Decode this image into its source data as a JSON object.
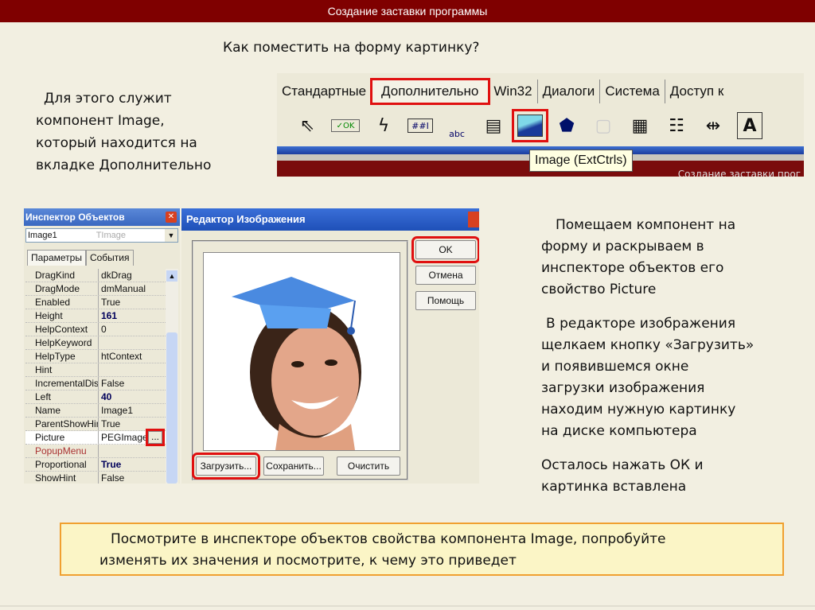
{
  "slide_title": "Создание заставки программы",
  "question": "Как поместить на форму картинку?",
  "left_text": [
    "Для этого служит",
    "компонент Image,",
    "который находится на",
    "вкладке Дополнительно"
  ],
  "palette": {
    "tabs": [
      "Стандартные",
      "Дополнительно",
      "Win32",
      "Диалоги",
      "Система",
      "Доступ к"
    ],
    "selected_tab": "Дополнительно",
    "tooltip": "Image (ExtCtrls)",
    "background_caption": "Создание заставки прог",
    "icon_labels": {
      "ok": "✓OK",
      "mask": "##I",
      "abc": "abc",
      "text": "A"
    }
  },
  "inspector": {
    "title": "Инспектор Объектов",
    "object": "Image1",
    "type": "TImage",
    "tabs": [
      "Параметры",
      "События"
    ],
    "rows": [
      {
        "k": "DragKind",
        "v": "dkDrag"
      },
      {
        "k": "DragMode",
        "v": "dmManual"
      },
      {
        "k": "Enabled",
        "v": "True"
      },
      {
        "k": "Height",
        "v": "161"
      },
      {
        "k": "HelpContext",
        "v": "0"
      },
      {
        "k": "HelpKeyword",
        "v": ""
      },
      {
        "k": "HelpType",
        "v": "htContext"
      },
      {
        "k": "Hint",
        "v": ""
      },
      {
        "k": "IncrementalDisp",
        "v": "False"
      },
      {
        "k": "Left",
        "v": "40"
      },
      {
        "k": "Name",
        "v": "Image1"
      },
      {
        "k": "ParentShowHint",
        "v": "True"
      },
      {
        "k": "Picture",
        "v": "PEGImage)"
      },
      {
        "k": "PopupMenu",
        "v": ""
      },
      {
        "k": "Proportional",
        "v": "True"
      },
      {
        "k": "ShowHint",
        "v": "False"
      }
    ],
    "ellipsis": "..."
  },
  "editor": {
    "title": "Редактор Изображения",
    "ok": "OK",
    "cancel": "Отмена",
    "help": "Помощь",
    "load": "Загрузить...",
    "save": "Сохранить...",
    "clear": "Очистить"
  },
  "right_text": {
    "p1": [
      "Помещаем компонент на",
      "форму и раскрываем в",
      "инспекторе объектов его",
      "свойство Picture"
    ],
    "p2": [
      "В редакторе изображения",
      "щелкаем кнопку «Загрузить»",
      "и появившемся окне",
      "загрузки изображения",
      "находим нужную картинку",
      "на диске компьютера"
    ],
    "p3": [
      "Осталось нажать ОК и",
      "картинка вставлена"
    ]
  },
  "note": [
    "Посмотрите в инспекторе объектов свойства компонента Image, попробуйте",
    "изменять их значения и посмотрите, к чему это приведет"
  ]
}
